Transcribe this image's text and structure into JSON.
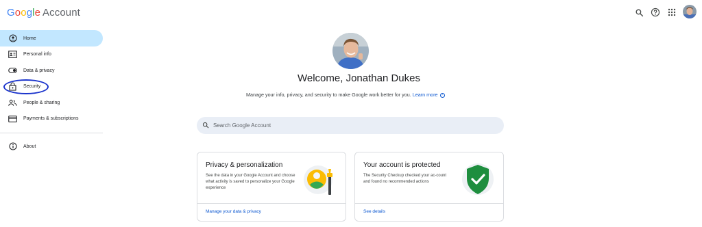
{
  "header": {
    "logo_letters": [
      "G",
      "o",
      "o",
      "g",
      "l",
      "e"
    ],
    "logo_word": "Account",
    "icons": [
      "search-icon",
      "help-icon",
      "apps-icon"
    ]
  },
  "sidebar": {
    "items": [
      {
        "label": "Home",
        "icon": "home-icon",
        "active": true
      },
      {
        "label": "Personal info",
        "icon": "id-card-icon"
      },
      {
        "label": "Data & privacy",
        "icon": "toggle-icon"
      },
      {
        "label": "Security",
        "icon": "lock-icon",
        "highlighted": true
      },
      {
        "label": "People & sharing",
        "icon": "people-icon"
      },
      {
        "label": "Payments & subscriptions",
        "icon": "credit-card-icon"
      }
    ],
    "footer_items": [
      {
        "label": "About",
        "icon": "info-icon"
      }
    ],
    "annotation_color": "#1a33cc"
  },
  "main": {
    "welcome": "Welcome, Jonathan Dukes",
    "subtitle": "Manage your info, privacy, and security to make Google work better for you.",
    "learn_more": "Learn more",
    "search": {
      "placeholder": "Search Google Account"
    }
  },
  "cards": [
    {
      "title": "Privacy & personalization",
      "description": "See the data in your Google Account and choose what activity is saved to personalize your Google experience",
      "link": "Manage your data & privacy"
    },
    {
      "title": "Your account is protected",
      "description": "The Security Checkup checked your ac-count and found no recommended actions",
      "link": "See details"
    }
  ],
  "colors": {
    "active_nav": "#c2e7ff",
    "search_bg": "#e9eef6",
    "link": "#0b57d0",
    "shield": "#1e8e3e"
  }
}
